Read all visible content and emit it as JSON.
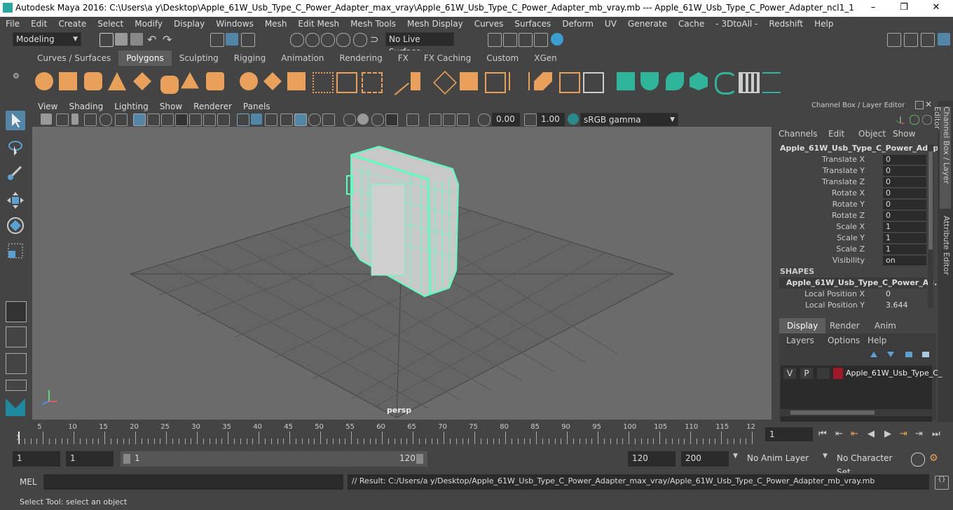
{
  "window": {
    "title": "Autodesk Maya 2016: C:\\Users\\a y\\Desktop\\Apple_61W_Usb_Type_C_Power_Adapter_max_vray\\Apple_61W_Usb_Type_C_Power_Adapter_mb_vray.mb   ---   Apple_61W_Usb_Type_C_Power_Adapter_ncl1_1",
    "minimize": "–",
    "maximize": "❐",
    "close": "✕"
  },
  "menubar": [
    "File",
    "Edit",
    "Create",
    "Select",
    "Modify",
    "Display",
    "Windows",
    "Mesh",
    "Edit Mesh",
    "Mesh Tools",
    "Mesh Display",
    "Curves",
    "Surfaces",
    "Deform",
    "UV",
    "Generate",
    "Cache",
    "- 3DtoAll -",
    "Redshift",
    "Help"
  ],
  "toolbar": {
    "mode": "Modeling",
    "live_surface": "No Live Surface"
  },
  "shelf_tabs": [
    "Curves / Surfaces",
    "Polygons",
    "Sculpting",
    "Rigging",
    "Animation",
    "Rendering",
    "FX",
    "FX Caching",
    "Custom",
    "XGen"
  ],
  "active_shelf_tab": "Polygons",
  "viewport": {
    "menu": [
      "View",
      "Shading",
      "Lighting",
      "Show",
      "Renderer",
      "Panels"
    ],
    "exposure": "0.00",
    "gamma": "1.00",
    "color_space": "sRGB gamma",
    "camera_label": "persp"
  },
  "channel_box": {
    "header": "Channel Box / Layer Editor",
    "menu": [
      "Channels",
      "Edit",
      "Object",
      "Show"
    ],
    "object_name": "Apple_61W_Usb_Type_C_Power_Adap...",
    "attributes": [
      {
        "label": "Translate X",
        "value": "0"
      },
      {
        "label": "Translate Y",
        "value": "0"
      },
      {
        "label": "Translate Z",
        "value": "0"
      },
      {
        "label": "Rotate X",
        "value": "0"
      },
      {
        "label": "Rotate Y",
        "value": "0"
      },
      {
        "label": "Rotate Z",
        "value": "0"
      },
      {
        "label": "Scale X",
        "value": "1"
      },
      {
        "label": "Scale Y",
        "value": "1"
      },
      {
        "label": "Scale Z",
        "value": "1"
      },
      {
        "label": "Visibility",
        "value": "on"
      }
    ],
    "shapes_header": "SHAPES",
    "shape_name": "Apple_61W_Usb_Type_C_Power_Ad...",
    "shape_attributes": [
      {
        "label": "Local Position X",
        "value": "0"
      },
      {
        "label": "Local Position Y",
        "value": "3.644"
      }
    ]
  },
  "side_tabs": [
    "Channel Box / Layer Editor",
    "Attribute Editor"
  ],
  "layer_editor": {
    "tabs": [
      "Display",
      "Render",
      "Anim"
    ],
    "active_tab": "Display",
    "menu": [
      "Layers",
      "Options",
      "Help"
    ],
    "layer": {
      "v": "V",
      "p": "P",
      "name": "Apple_61W_Usb_Type_C_",
      "color": "#a0182a"
    }
  },
  "timeline": {
    "ticks": [
      "5",
      "10",
      "15",
      "20",
      "25",
      "30",
      "35",
      "40",
      "45",
      "50",
      "55",
      "60",
      "65",
      "70",
      "75",
      "80",
      "85",
      "90",
      "95",
      "100",
      "105",
      "110",
      "115",
      "12"
    ],
    "start_marker": "1",
    "current_frame": "1"
  },
  "range": {
    "start": "1",
    "playback_start": "1",
    "slider_start": "1",
    "slider_end": "120",
    "playback_end": "120",
    "end": "200",
    "anim_layer": "No Anim Layer",
    "character_set": "No Character Set"
  },
  "command_line": {
    "label": "MEL",
    "result": "// Result: C:/Users/a y/Desktop/Apple_61W_Usb_Type_C_Power_Adapter_max_vray/Apple_61W_Usb_Type_C_Power_Adapter_mb_vray.mb"
  },
  "status": "Select Tool: select an object",
  "colors": {
    "accent": "#5285a6",
    "shelf_orange": "#e8a05a",
    "shelf_teal": "#2fb59a",
    "mesh_wire": "#5affc0",
    "layer_color": "#a0182a"
  }
}
